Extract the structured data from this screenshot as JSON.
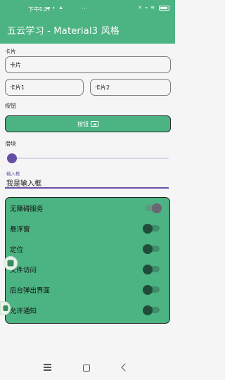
{
  "status_bar": {
    "time": "下午5:27",
    "left_icons": "☁ ◐ ▲",
    "more": "···",
    "right_icons": "✕ ⌁ ≋",
    "battery_level": 0.78
  },
  "app_bar": {
    "title": "五云学习 - Material3 风格"
  },
  "card_section": {
    "label": "卡片",
    "full_card_text": "卡片",
    "card1_text": "卡片1",
    "card2_text": "卡片2"
  },
  "button_section": {
    "label": "按钮",
    "button_label": "按钮"
  },
  "slider_section": {
    "label": "滑块",
    "value": 0.0
  },
  "input_section": {
    "label": "输入框",
    "value": "我是输入框"
  },
  "settings": {
    "items": [
      {
        "label": "无障碍服务",
        "enabled": true
      },
      {
        "label": "悬浮窗",
        "enabled": false
      },
      {
        "label": "定位",
        "enabled": false
      },
      {
        "label": "文件访问",
        "enabled": false
      },
      {
        "label": "后台弹出界面",
        "enabled": false
      },
      {
        "label": "允许通知",
        "enabled": false
      }
    ]
  },
  "colors": {
    "primary": "#4cb383",
    "accent": "#6750a4"
  },
  "floating_icons": [
    "app-shortcut-icon",
    "app-shortcut-icon"
  ]
}
